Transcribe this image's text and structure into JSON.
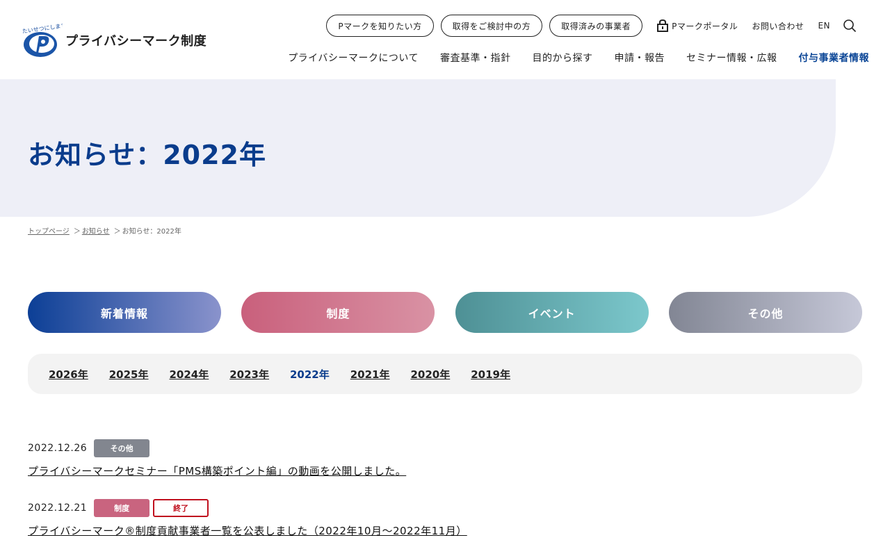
{
  "header": {
    "logo_text": "プライバシーマーク制度",
    "logo_tagline": "たいせつにしますプライバシー",
    "top_links": [
      "Pマークを知りたい方",
      "取得をご検討中の方",
      "取得済みの事業者"
    ],
    "portal_label": "Pマークポータル",
    "contact_label": "お問い合わせ",
    "lang_label": "EN",
    "nav": [
      "プライバシーマークについて",
      "審査基準・指針",
      "目的から探す",
      "申請・報告",
      "セミナー情報・広報",
      "付与事業者情報"
    ]
  },
  "hero": {
    "title": "お知らせ：2022年"
  },
  "breadcrumb": {
    "home": "トップページ",
    "news": "お知らせ",
    "current": "お知らせ：2022年",
    "separator": "＞"
  },
  "categories": [
    "新着情報",
    "制度",
    "イベント",
    "その他"
  ],
  "years": [
    "2026年",
    "2025年",
    "2024年",
    "2023年",
    "2022年",
    "2021年",
    "2020年",
    "2019年"
  ],
  "news": [
    {
      "date": "2022.12.26",
      "tags": [
        "その他"
      ],
      "title": "プライバシーマークセミナー「PMS構築ポイント編」の動画を公開しました。"
    },
    {
      "date": "2022.12.21",
      "tags": [
        "制度",
        "終了"
      ],
      "title": "プライバシーマーク®制度貢献事業者一覧を公表しました（2022年10月～2022年11月）"
    }
  ],
  "colors": {
    "primary": "#0a3c8c",
    "hero_bg": "#eeeff7",
    "ended": "#c0101e"
  }
}
